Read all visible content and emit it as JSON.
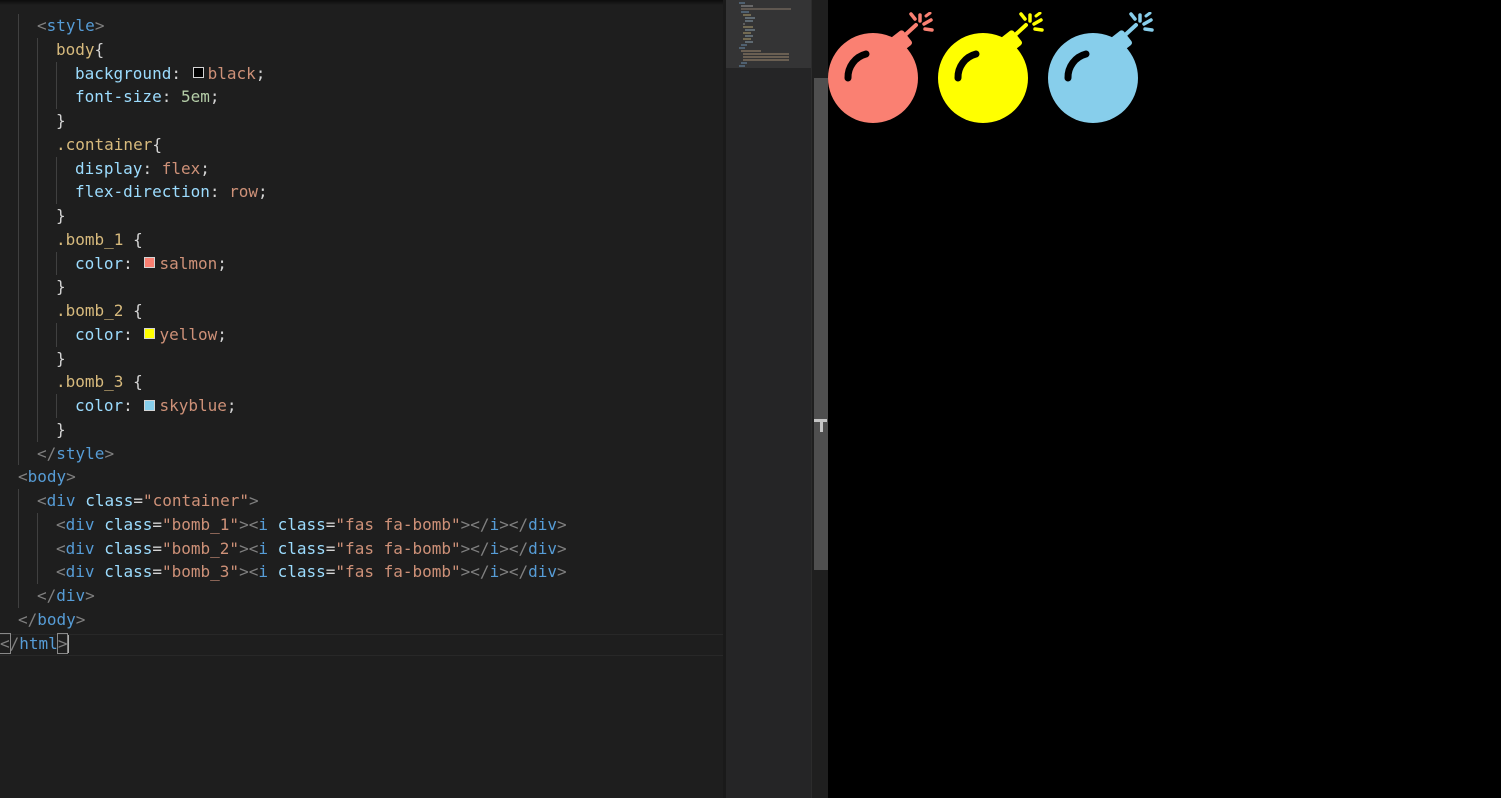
{
  "editor": {
    "lines": [
      {
        "indent": 1,
        "tokens": [
          [
            "p",
            "<"
          ],
          [
            "t",
            "style"
          ],
          [
            "p",
            ">"
          ]
        ]
      },
      {
        "indent": 2,
        "tokens": [
          [
            "sel",
            "body"
          ],
          [
            "d",
            "{"
          ]
        ]
      },
      {
        "indent": 3,
        "tokens": [
          [
            "pr",
            "background"
          ],
          [
            "d",
            ": "
          ],
          [
            "swatch",
            "#000000"
          ],
          [
            "v",
            "black"
          ],
          [
            "d",
            ";"
          ]
        ]
      },
      {
        "indent": 3,
        "tokens": [
          [
            "pr",
            "font-size"
          ],
          [
            "d",
            ": "
          ],
          [
            "n",
            "5em"
          ],
          [
            "d",
            ";"
          ]
        ]
      },
      {
        "indent": 2,
        "tokens": [
          [
            "d",
            "}"
          ]
        ]
      },
      {
        "indent": 2,
        "tokens": [
          [
            "sel",
            ".container"
          ],
          [
            "d",
            "{"
          ]
        ]
      },
      {
        "indent": 3,
        "tokens": [
          [
            "pr",
            "display"
          ],
          [
            "d",
            ": "
          ],
          [
            "v",
            "flex"
          ],
          [
            "d",
            ";"
          ]
        ]
      },
      {
        "indent": 3,
        "tokens": [
          [
            "pr",
            "flex-direction"
          ],
          [
            "d",
            ": "
          ],
          [
            "v",
            "row"
          ],
          [
            "d",
            ";"
          ]
        ]
      },
      {
        "indent": 2,
        "tokens": [
          [
            "d",
            "}"
          ]
        ]
      },
      {
        "indent": 2,
        "tokens": [
          [
            "sel",
            ".bomb_1"
          ],
          [
            "d",
            " {"
          ]
        ]
      },
      {
        "indent": 3,
        "tokens": [
          [
            "pr",
            "color"
          ],
          [
            "d",
            ": "
          ],
          [
            "swatch",
            "#fa8072"
          ],
          [
            "v",
            "salmon"
          ],
          [
            "d",
            ";"
          ]
        ]
      },
      {
        "indent": 2,
        "tokens": [
          [
            "d",
            "}"
          ]
        ]
      },
      {
        "indent": 2,
        "tokens": [
          [
            "sel",
            ".bomb_2"
          ],
          [
            "d",
            " {"
          ]
        ]
      },
      {
        "indent": 3,
        "tokens": [
          [
            "pr",
            "color"
          ],
          [
            "d",
            ": "
          ],
          [
            "swatch",
            "#ffff00"
          ],
          [
            "v",
            "yellow"
          ],
          [
            "d",
            ";"
          ]
        ]
      },
      {
        "indent": 2,
        "tokens": [
          [
            "d",
            "}"
          ]
        ]
      },
      {
        "indent": 2,
        "tokens": [
          [
            "sel",
            ".bomb_3"
          ],
          [
            "d",
            " {"
          ]
        ]
      },
      {
        "indent": 3,
        "tokens": [
          [
            "pr",
            "color"
          ],
          [
            "d",
            ": "
          ],
          [
            "swatch",
            "#87ceeb"
          ],
          [
            "v",
            "skyblue"
          ],
          [
            "d",
            ";"
          ]
        ]
      },
      {
        "indent": 2,
        "tokens": [
          [
            "d",
            "}"
          ]
        ]
      },
      {
        "indent": 1,
        "tokens": [
          [
            "p",
            "</"
          ],
          [
            "t",
            "style"
          ],
          [
            "p",
            ">"
          ]
        ]
      },
      {
        "indent": 0,
        "tokens": [
          [
            "p",
            "<"
          ],
          [
            "t",
            "body"
          ],
          [
            "p",
            ">"
          ]
        ]
      },
      {
        "indent": 1,
        "tokens": [
          [
            "p",
            "<"
          ],
          [
            "t",
            "div"
          ],
          [
            "d",
            " "
          ],
          [
            "a",
            "class"
          ],
          [
            "d",
            "="
          ],
          [
            "s",
            "\"container\""
          ],
          [
            "p",
            ">"
          ]
        ]
      },
      {
        "indent": 2,
        "tokens": [
          [
            "p",
            "<"
          ],
          [
            "t",
            "div"
          ],
          [
            "d",
            " "
          ],
          [
            "a",
            "class"
          ],
          [
            "d",
            "="
          ],
          [
            "s",
            "\"bomb_1\""
          ],
          [
            "p",
            "><"
          ],
          [
            "t",
            "i"
          ],
          [
            "d",
            " "
          ],
          [
            "a",
            "class"
          ],
          [
            "d",
            "="
          ],
          [
            "s",
            "\"fas fa-bomb\""
          ],
          [
            "p",
            "></"
          ],
          [
            "t",
            "i"
          ],
          [
            "p",
            "></"
          ],
          [
            "t",
            "div"
          ],
          [
            "p",
            ">"
          ]
        ]
      },
      {
        "indent": 2,
        "tokens": [
          [
            "p",
            "<"
          ],
          [
            "t",
            "div"
          ],
          [
            "d",
            " "
          ],
          [
            "a",
            "class"
          ],
          [
            "d",
            "="
          ],
          [
            "s",
            "\"bomb_2\""
          ],
          [
            "p",
            "><"
          ],
          [
            "t",
            "i"
          ],
          [
            "d",
            " "
          ],
          [
            "a",
            "class"
          ],
          [
            "d",
            "="
          ],
          [
            "s",
            "\"fas fa-bomb\""
          ],
          [
            "p",
            "></"
          ],
          [
            "t",
            "i"
          ],
          [
            "p",
            "></"
          ],
          [
            "t",
            "div"
          ],
          [
            "p",
            ">"
          ]
        ]
      },
      {
        "indent": 2,
        "tokens": [
          [
            "p",
            "<"
          ],
          [
            "t",
            "div"
          ],
          [
            "d",
            " "
          ],
          [
            "a",
            "class"
          ],
          [
            "d",
            "="
          ],
          [
            "s",
            "\"bomb_3\""
          ],
          [
            "p",
            "><"
          ],
          [
            "t",
            "i"
          ],
          [
            "d",
            " "
          ],
          [
            "a",
            "class"
          ],
          [
            "d",
            "="
          ],
          [
            "s",
            "\"fas fa-bomb\""
          ],
          [
            "p",
            "></"
          ],
          [
            "t",
            "i"
          ],
          [
            "p",
            "></"
          ],
          [
            "t",
            "div"
          ],
          [
            "p",
            ">"
          ]
        ]
      },
      {
        "indent": 1,
        "tokens": [
          [
            "p",
            "</"
          ],
          [
            "t",
            "div"
          ],
          [
            "p",
            ">"
          ]
        ]
      },
      {
        "indent": 0,
        "tokens": [
          [
            "p",
            "</"
          ],
          [
            "t",
            "body"
          ],
          [
            "p",
            ">"
          ]
        ]
      },
      {
        "indent": -1,
        "tokens": [
          [
            "bracket",
            "<"
          ],
          [
            "p",
            "/"
          ],
          [
            "t",
            "html"
          ],
          [
            "bracket",
            ">"
          ],
          [
            "cursor",
            ""
          ]
        ]
      }
    ]
  },
  "preview": {
    "background": "#000000",
    "bombs": [
      {
        "name": "bomb-1-icon",
        "color": "#fa8072"
      },
      {
        "name": "bomb-2-icon",
        "color": "#ffff00"
      },
      {
        "name": "bomb-3-icon",
        "color": "#87ceeb"
      }
    ]
  }
}
